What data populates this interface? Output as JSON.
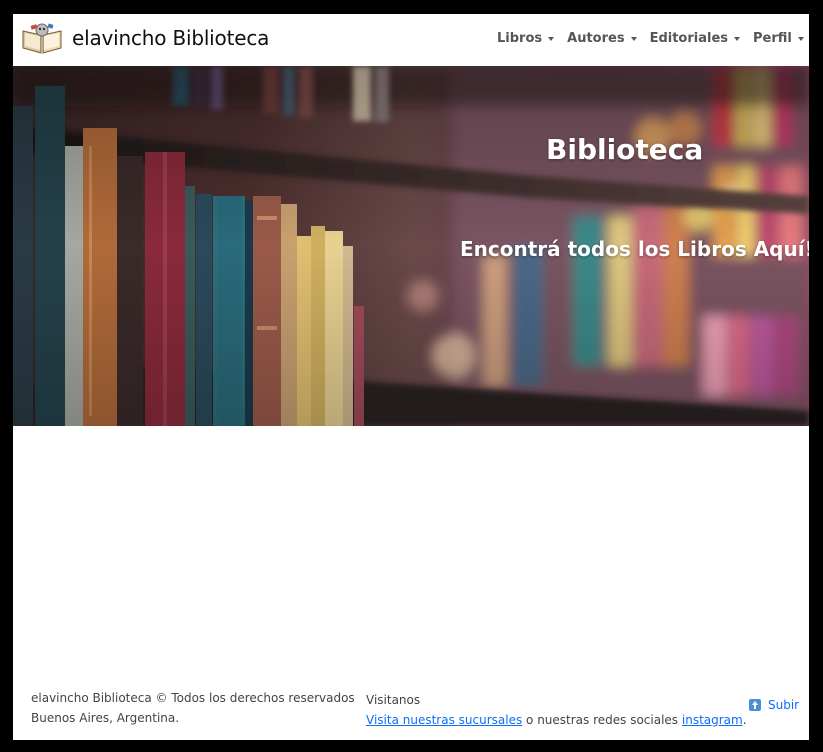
{
  "brand": {
    "name": "elavincho Biblioteca",
    "logo_icon": "library-reading-icon"
  },
  "nav": {
    "items": [
      {
        "label": "Libros",
        "icon": "caret-down-icon"
      },
      {
        "label": "Autores",
        "icon": "caret-down-icon"
      },
      {
        "label": "Editoriales",
        "icon": "caret-down-icon"
      },
      {
        "label": "Perfil",
        "icon": "caret-down-icon"
      }
    ]
  },
  "hero": {
    "title": "Biblioteca",
    "subtitle": "Encontrá todos los Libros Aquí!"
  },
  "footer": {
    "copyright": "elavincho Biblioteca © Todos los derechos reservados",
    "location": "Buenos Aires, Argentina.",
    "visit_heading": "Visitanos",
    "branches_link": "Visita nuestras sucursales",
    "middle_text": " o nuestras redes sociales ",
    "instagram_link": "instagram",
    "period": ".",
    "up_label": "Subir",
    "up_icon": "arrow-up-icon"
  },
  "colors": {
    "link": "#0d6efd",
    "nav_text": "#555555",
    "background": "#ffffff"
  }
}
